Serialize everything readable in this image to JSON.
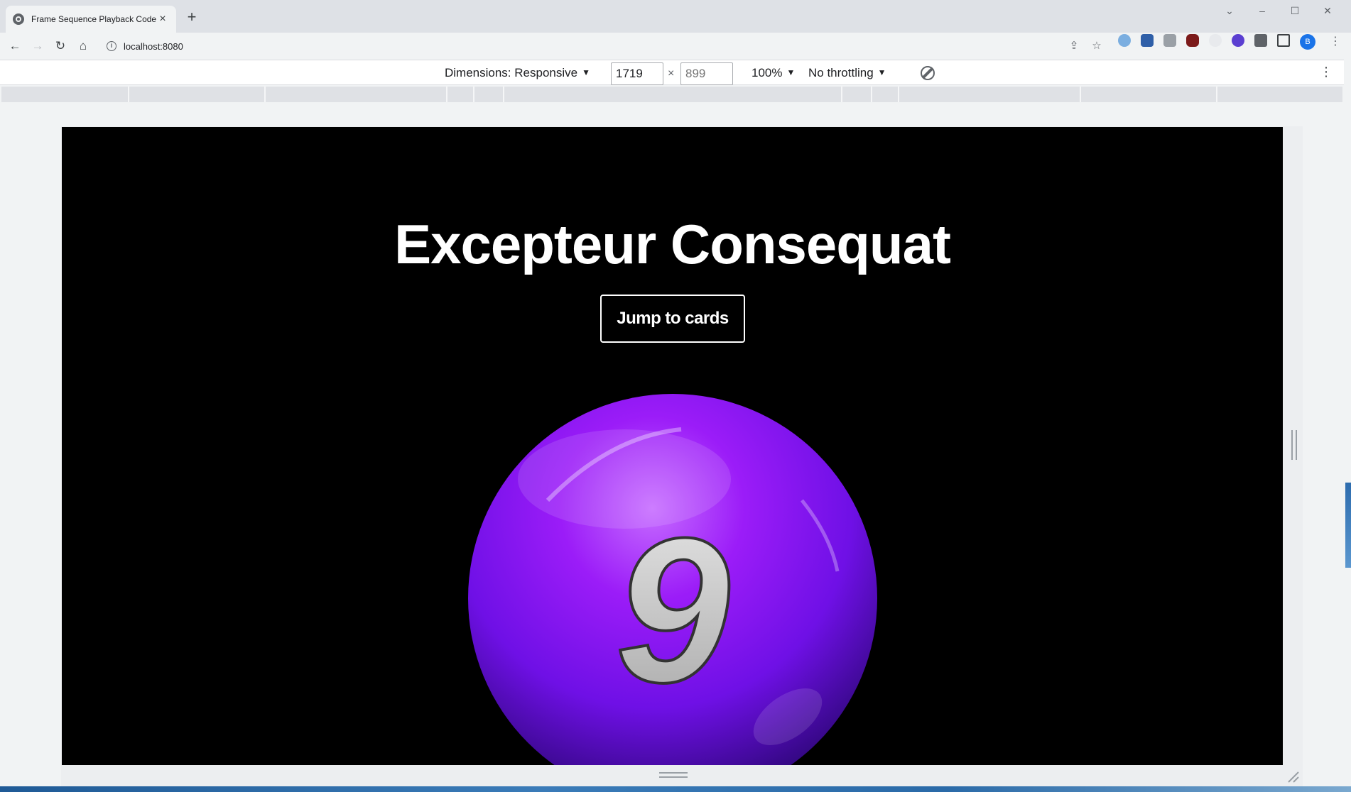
{
  "browser": {
    "tab_title": "Frame Sequence Playback Code",
    "url": "localhost:8080",
    "profile_initial": "B",
    "tab_close_glyph": "×",
    "new_tab_glyph": "+"
  },
  "device_toolbar": {
    "dimensions_label": "Dimensions: Responsive",
    "width_value": "1719",
    "height_placeholder": "899",
    "times_symbol": "×",
    "zoom_label": "100%",
    "throttling_label": "No throttling"
  },
  "page": {
    "title": "Excepteur Consequat",
    "jump_button_label": "Jump to cards",
    "ball_number": "9",
    "ball_color": "#7a10f0"
  },
  "colors": {
    "page_background": "#000000",
    "chrome_frame": "#dee1e6",
    "accent_blue": "#1a73e8"
  }
}
